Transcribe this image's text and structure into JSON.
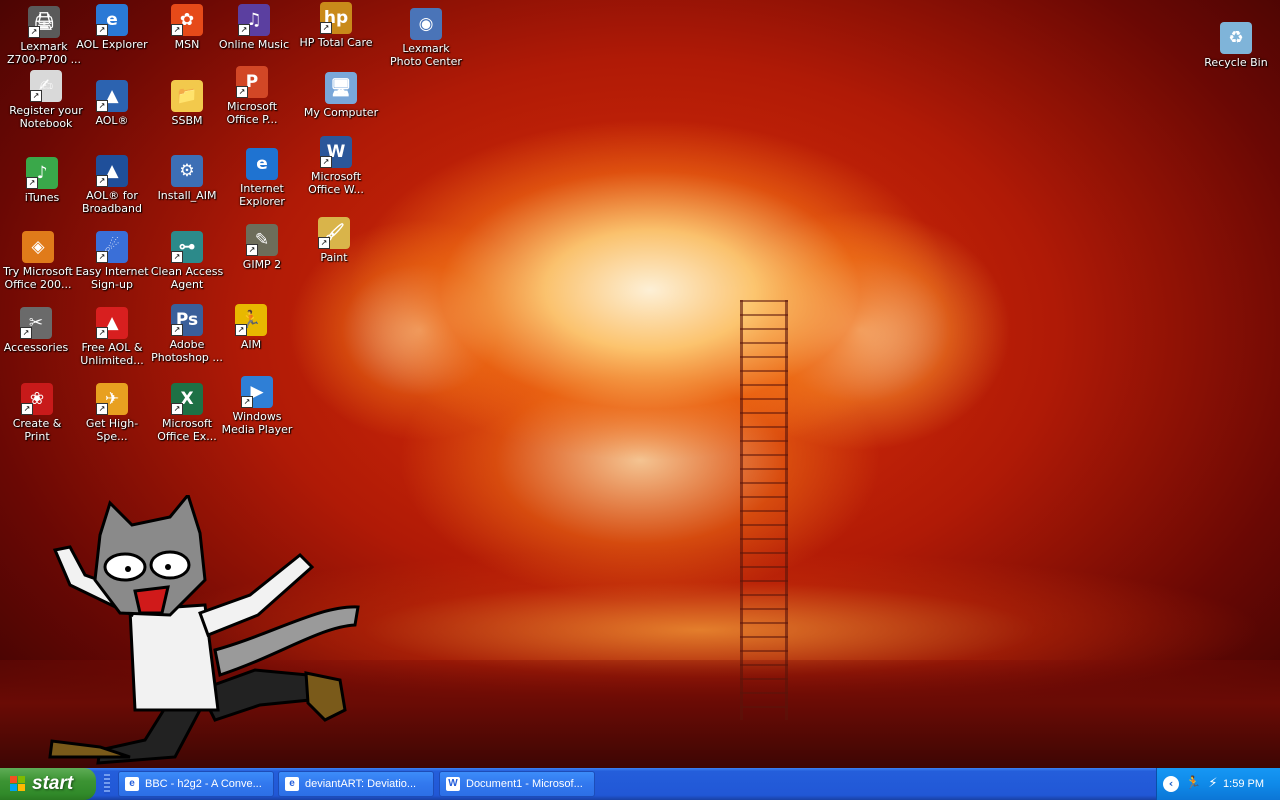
{
  "desktop": {
    "icons": [
      {
        "label": "Lexmark Z700-P700 ...",
        "icon": "printer-icon",
        "glyph": "🖨",
        "color": "#5a5a5a"
      },
      {
        "label": "AOL Explorer",
        "icon": "aol-explorer-icon",
        "glyph": "e",
        "color": "#2a79d6"
      },
      {
        "label": "MSN",
        "icon": "msn-butterfly-icon",
        "glyph": "✿",
        "color": "#e64a19"
      },
      {
        "label": "Online Music",
        "icon": "music-note-icon",
        "glyph": "♫",
        "color": "#5b3fa0"
      },
      {
        "label": "HP Total Care",
        "icon": "hp-total-care-icon",
        "glyph": "hp",
        "color": "#c98a1a"
      },
      {
        "label": "Lexmark Photo Center",
        "icon": "lexmark-photo-icon",
        "glyph": "◉",
        "color": "#4a74b8"
      },
      {
        "label": "Register your Notebook",
        "icon": "register-notebook-icon",
        "glyph": "✍",
        "color": "#d9d9d9"
      },
      {
        "label": "AOL®",
        "icon": "aol-icon",
        "glyph": "▲",
        "color": "#2c63b0"
      },
      {
        "label": "SSBM",
        "icon": "folder-icon",
        "glyph": "📁",
        "color": "#f2c94c"
      },
      {
        "label": "Microsoft Office P...",
        "icon": "powerpoint-icon",
        "glyph": "P",
        "color": "#d24726"
      },
      {
        "label": "My Computer",
        "icon": "my-computer-icon",
        "glyph": "🖥",
        "color": "#7aa7d9"
      },
      {
        "label": "iTunes",
        "icon": "itunes-icon",
        "glyph": "♪",
        "color": "#3aa84a"
      },
      {
        "label": "AOL® for Broadband",
        "icon": "aol-broadband-icon",
        "glyph": "▲",
        "color": "#1f4f9a"
      },
      {
        "label": "Install_AIM",
        "icon": "install-aim-icon",
        "glyph": "⚙",
        "color": "#3d6fb5"
      },
      {
        "label": "Internet Explorer",
        "icon": "internet-explorer-icon",
        "glyph": "e",
        "color": "#1f73d1"
      },
      {
        "label": "Microsoft Office W...",
        "icon": "word-icon",
        "glyph": "W",
        "color": "#2b579a"
      },
      {
        "label": "Try Microsoft Office 200...",
        "icon": "office-trial-icon",
        "glyph": "◈",
        "color": "#e07b1a"
      },
      {
        "label": "Easy Internet Sign-up",
        "icon": "easy-internet-signup-icon",
        "glyph": "☄",
        "color": "#3a6fd8"
      },
      {
        "label": "Clean Access Agent",
        "icon": "clean-access-agent-icon",
        "glyph": "⊶",
        "color": "#2c8a8a"
      },
      {
        "label": "GIMP 2",
        "icon": "gimp-icon",
        "glyph": "✎",
        "color": "#6d6d5a"
      },
      {
        "label": "Paint",
        "icon": "paint-icon",
        "glyph": "🖌",
        "color": "#d9b44a"
      },
      {
        "label": "Accessories",
        "icon": "accessories-icon",
        "glyph": "✂",
        "color": "#6a6a6a"
      },
      {
        "label": "Free AOL & Unlimited...",
        "icon": "free-aol-icon",
        "glyph": "▲",
        "color": "#d81f1f"
      },
      {
        "label": "Adobe Photoshop ...",
        "icon": "photoshop-icon",
        "glyph": "Ps",
        "color": "#3a5f9a"
      },
      {
        "label": "AIM",
        "icon": "aim-running-man-icon",
        "glyph": "🏃",
        "color": "#e8b800"
      },
      {
        "label": "Create & Print",
        "icon": "create-print-rose-icon",
        "glyph": "❀",
        "color": "#c81a1a"
      },
      {
        "label": "Get High-Spe...",
        "icon": "get-high-speed-icon",
        "glyph": "✈",
        "color": "#e8a020"
      },
      {
        "label": "Microsoft Office Ex...",
        "icon": "excel-icon",
        "glyph": "X",
        "color": "#1e7145"
      },
      {
        "label": "Windows Media Player",
        "icon": "windows-media-player-icon",
        "glyph": "▶",
        "color": "#2f7fd6"
      },
      {
        "label": "Recycle Bin",
        "icon": "recycle-bin-icon",
        "glyph": "♻",
        "color": "#7fb4d9"
      }
    ]
  },
  "taskbar": {
    "start_label": "start",
    "tasks": [
      {
        "label": "BBC - h2g2 - A Conve...",
        "icon": "internet-explorer-icon",
        "glyph": "e"
      },
      {
        "label": "deviantART: Deviatio...",
        "icon": "internet-explorer-icon",
        "glyph": "e"
      },
      {
        "label": "Document1 - Microsof...",
        "icon": "word-icon",
        "glyph": "W"
      }
    ],
    "tray": {
      "show_hidden_icon": "chevron-left-icon",
      "icons": [
        "aim-running-man-icon",
        "network-icon"
      ],
      "clock": "1:59 PM"
    }
  },
  "colors": {
    "taskbar_blue": "#245edb",
    "start_green": "#3c9433",
    "tray_blue": "#0f8ae9"
  }
}
